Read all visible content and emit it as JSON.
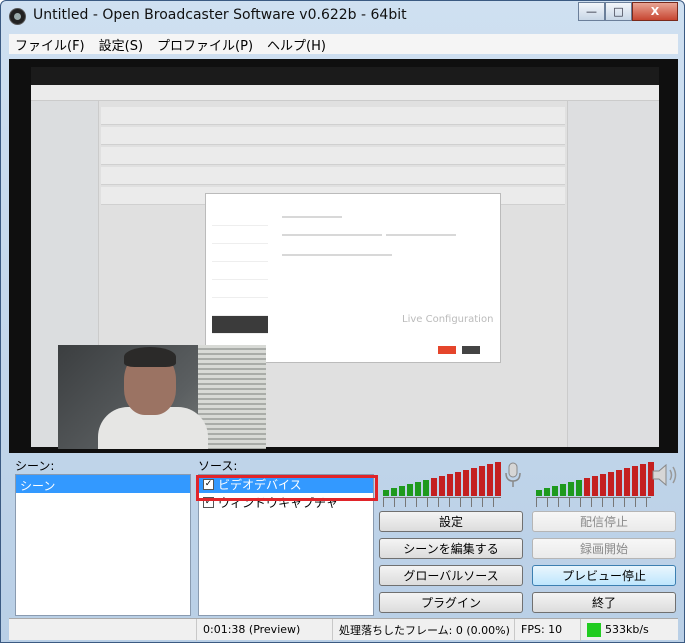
{
  "window": {
    "title": "Untitled - Open Broadcaster Software v0.622b - 64bit",
    "minimize_label": "—",
    "maximize_label": "□",
    "close_label": "X"
  },
  "menu": {
    "items": [
      "ファイル(F)",
      "設定(S)",
      "プロファイル(P)",
      "ヘルプ(H)"
    ]
  },
  "scenes": {
    "label": "シーン:",
    "items": [
      "シーン"
    ]
  },
  "sources": {
    "label": "ソース:",
    "items": [
      {
        "name": "ビデオデバイス",
        "checked": true,
        "selected": true
      },
      {
        "name": "ウィンドウキャプチャ",
        "checked": true,
        "selected": false
      }
    ]
  },
  "buttons": {
    "settings": "設定",
    "stop_stream": "配信停止",
    "edit_scene": "シーンを編集する",
    "start_recording": "録画開始",
    "global_sources": "グローバルソース",
    "stop_preview": "プレビュー停止",
    "plugins": "プラグイン",
    "exit": "終了"
  },
  "status": {
    "time": "0:01:38 (Preview)",
    "dropped_frames": "処理落ちしたフレーム: 0 (0.00%)",
    "fps": "FPS: 10",
    "bitrate": "533kb/s",
    "bitrate_color": "#22cc22"
  },
  "preview_dialog": {
    "live_config": "Live Configuration"
  },
  "icons": {
    "mic": "microphone-icon",
    "speaker": "speaker-icon"
  }
}
